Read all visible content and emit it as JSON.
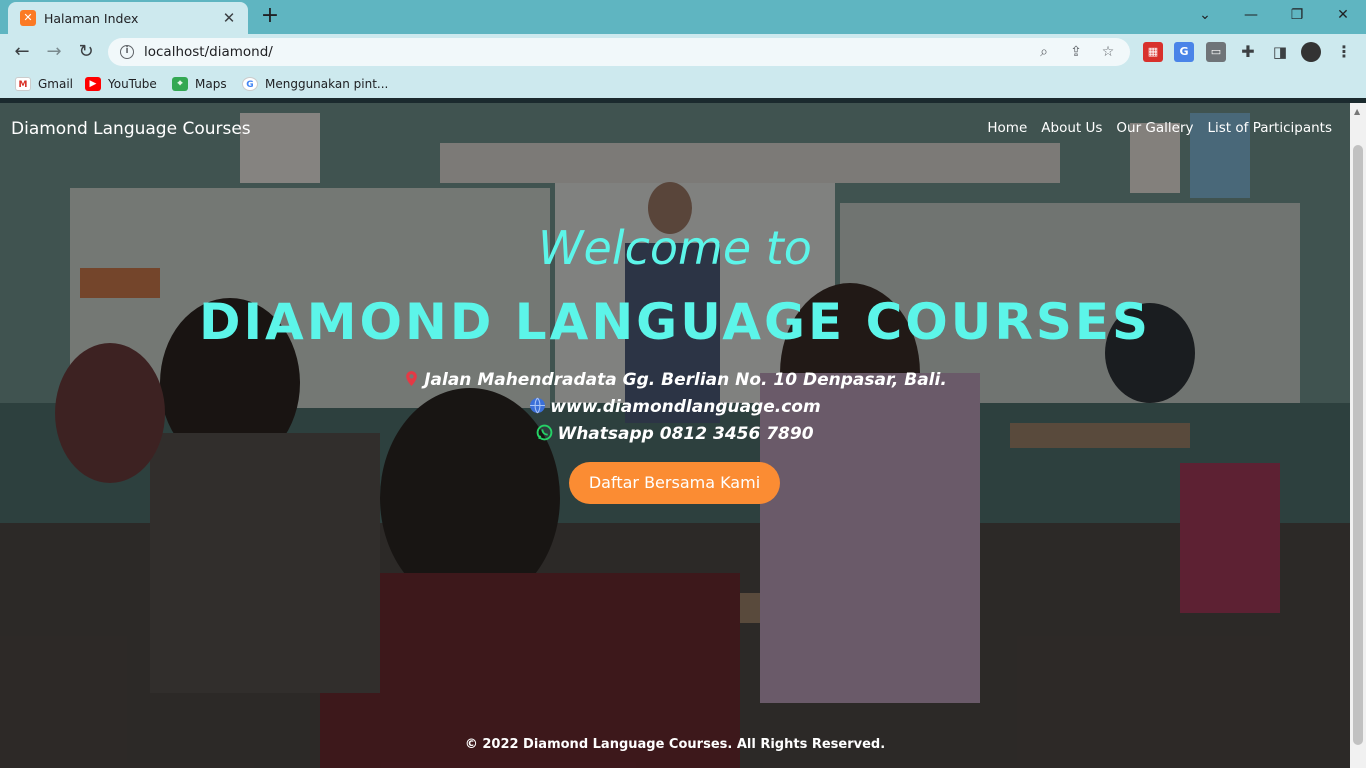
{
  "browser": {
    "tab_title": "Halaman Index",
    "url": "localhost/diamond/",
    "bookmarks": [
      {
        "label": "Gmail",
        "icon": "gmail-icon"
      },
      {
        "label": "YouTube",
        "icon": "youtube-icon"
      },
      {
        "label": "Maps",
        "icon": "maps-icon"
      },
      {
        "label": "Menggunakan pint...",
        "icon": "google-icon"
      }
    ],
    "colors": {
      "tabbar": "#5fb5c1",
      "toolbar": "#cde9ee"
    }
  },
  "site": {
    "brand": "Diamond Language Courses",
    "nav": [
      "Home",
      "About Us",
      "Our Gallery",
      "List of Participants"
    ],
    "welcome": "Welcome to",
    "headline": "DIAMOND LANGUAGE COURSES",
    "address": "Jalan Mahendradata Gg. Berlian No. 10 Denpasar, Bali.",
    "website": "www.diamondlanguage.com",
    "whatsapp": "Whatsapp 0812 3456 7890",
    "cta": "Daftar Bersama Kami",
    "footer": "© 2022 Diamond Language Courses. All Rights Reserved.",
    "colors": {
      "accent": "#5cf5e9",
      "cta": "#fb8c33"
    }
  }
}
